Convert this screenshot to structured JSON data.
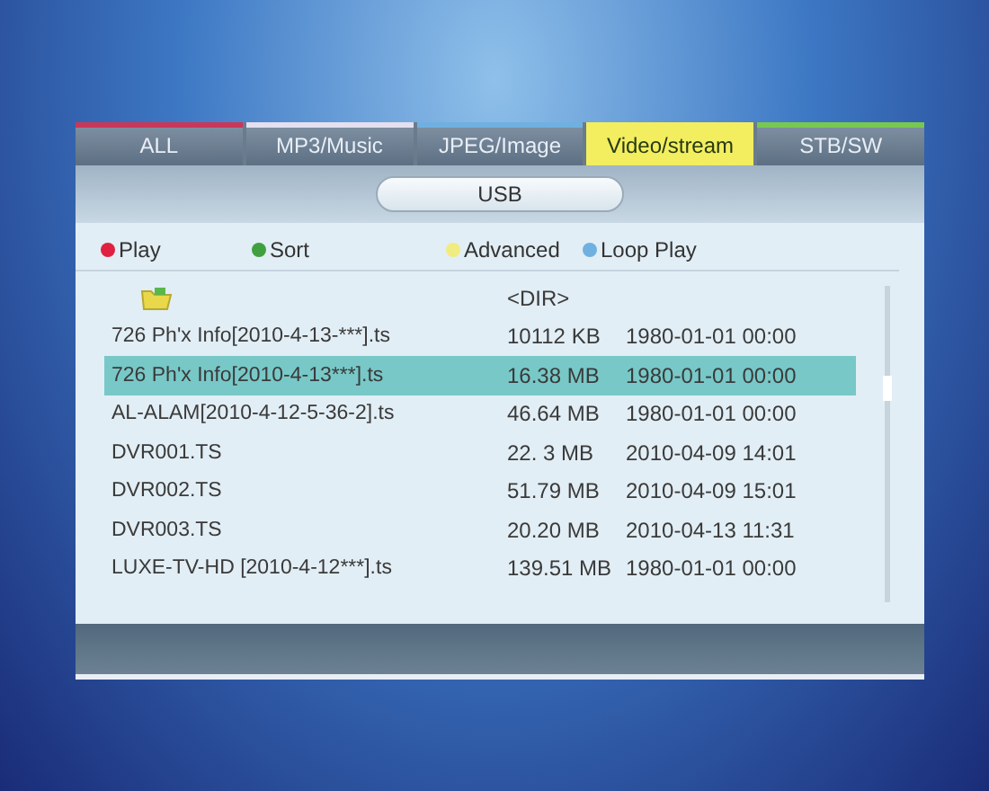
{
  "tabs": [
    {
      "label": "ALL",
      "selected": false,
      "color": "#c8385a"
    },
    {
      "label": "MP3/Music",
      "selected": false,
      "color": "#e4e0f0"
    },
    {
      "label": "JPEG/Image",
      "selected": false,
      "color": "#6fb0e0"
    },
    {
      "label": "Video/stream",
      "selected": true,
      "color": "#f2ee60"
    },
    {
      "label": "STB/SW",
      "selected": false,
      "color": "#78c850"
    }
  ],
  "device": "USB",
  "legend": [
    {
      "label": "Play",
      "color": "#e02040"
    },
    {
      "label": "Sort",
      "color": "#40a040"
    },
    {
      "label": "Advanced",
      "color": "#f0ec80"
    },
    {
      "label": "Loop Play",
      "color": "#70b0e0"
    }
  ],
  "files": [
    {
      "kind": "dir",
      "size": "<DIR>",
      "selected": false
    },
    {
      "kind": "file",
      "name": "726 Ph'x Info[2010-4-13-***].ts",
      "size": "10112 KB",
      "date": "1980-01-01 00:00",
      "selected": false
    },
    {
      "kind": "file",
      "name": "726 Ph'x Info[2010-4-13***].ts",
      "size": "16.38 MB",
      "date": "1980-01-01 00:00",
      "selected": true
    },
    {
      "kind": "file",
      "name": "AL-ALAM[2010-4-12-5-36-2].ts",
      "size": "46.64 MB",
      "date": "1980-01-01 00:00",
      "selected": false
    },
    {
      "kind": "file",
      "name": "DVR001.TS",
      "size": "22. 3 MB",
      "date": "2010-04-09 14:01",
      "selected": false
    },
    {
      "kind": "file",
      "name": "DVR002.TS",
      "size": "51.79 MB",
      "date": "2010-04-09 15:01",
      "selected": false
    },
    {
      "kind": "file",
      "name": "DVR003.TS",
      "size": "20.20 MB",
      "date": "2010-04-13 11:31",
      "selected": false
    },
    {
      "kind": "file",
      "name": "LUXE-TV-HD [2010-4-12***].ts",
      "size": "139.51 MB",
      "date": "1980-01-01 00:00",
      "selected": false
    }
  ]
}
